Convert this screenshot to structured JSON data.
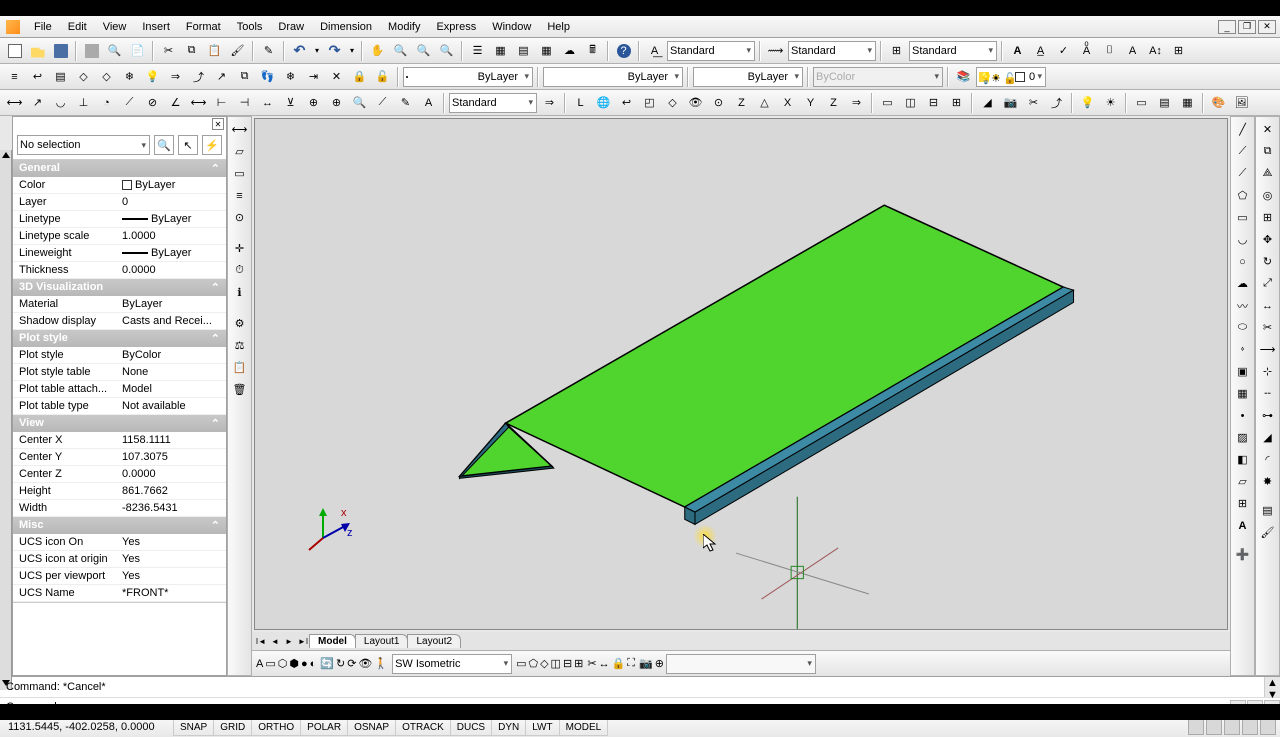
{
  "menu": [
    "File",
    "Edit",
    "View",
    "Insert",
    "Format",
    "Tools",
    "Draw",
    "Dimension",
    "Modify",
    "Express",
    "Window",
    "Help"
  ],
  "toolbar2_combo1": "Standard",
  "toolbar2_combo2": "Standard",
  "toolbar2_combo3": "Standard",
  "layer_combo": "ByLayer",
  "linetype_combo": "ByLayer",
  "lineweight_combo": "ByLayer",
  "color_combo": "ByColor",
  "layer_name_combo": "0",
  "dimstyle_combo": "Standard",
  "props_sel": "No selection",
  "props": {
    "general_title": "General",
    "color_k": "Color",
    "color_v": "ByLayer",
    "layer_k": "Layer",
    "layer_v": "0",
    "linetype_k": "Linetype",
    "linetype_v": "ByLayer",
    "ltscale_k": "Linetype scale",
    "ltscale_v": "1.0000",
    "lweight_k": "Lineweight",
    "lweight_v": "ByLayer",
    "thick_k": "Thickness",
    "thick_v": "0.0000",
    "vis3d_title": "3D Visualization",
    "mat_k": "Material",
    "mat_v": "ByLayer",
    "shadow_k": "Shadow display",
    "shadow_v": "Casts and Recei...",
    "plot_title": "Plot style",
    "pstyle_k": "Plot style",
    "pstyle_v": "ByColor",
    "pstable_k": "Plot style table",
    "pstable_v": "None",
    "ptattach_k": "Plot table attach...",
    "ptattach_v": "Model",
    "pttype_k": "Plot table type",
    "pttype_v": "Not available",
    "view_title": "View",
    "cx_k": "Center X",
    "cx_v": "1158.1111",
    "cy_k": "Center Y",
    "cy_v": "107.3075",
    "cz_k": "Center Z",
    "cz_v": "0.0000",
    "h_k": "Height",
    "h_v": "861.7662",
    "w_k": "Width",
    "w_v": "-8236.5431",
    "misc_title": "Misc",
    "ucs1_k": "UCS icon On",
    "ucs1_v": "Yes",
    "ucs2_k": "UCS icon at origin",
    "ucs2_v": "Yes",
    "ucs3_k": "UCS per viewport",
    "ucs3_v": "Yes",
    "ucs4_k": "UCS Name",
    "ucs4_v": "*FRONT*"
  },
  "tabs": {
    "model": "Model",
    "l1": "Layout1",
    "l2": "Layout2"
  },
  "view_combo": "SW Isometric",
  "cmd_hist": "Command: *Cancel*",
  "cmd_prompt": "Command:",
  "status": {
    "coords": "1131.5445, -402.0258, 0.0000",
    "toggles": [
      "SNAP",
      "GRID",
      "ORTHO",
      "POLAR",
      "OSNAP",
      "OTRACK",
      "DUCS",
      "DYN",
      "LWT",
      "MODEL"
    ]
  }
}
